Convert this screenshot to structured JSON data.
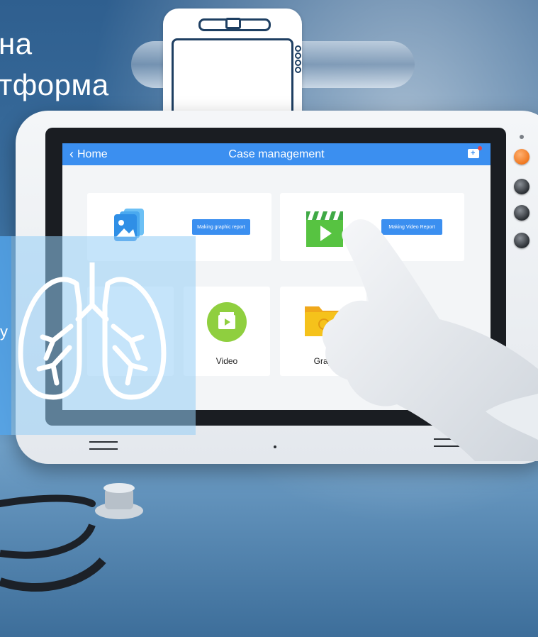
{
  "promo": {
    "line1": "на",
    "line2": "тформа",
    "side_fragment": "у"
  },
  "app": {
    "back_label": "Home",
    "title": "Case management",
    "cards": {
      "graphic_report_button": "Making graphic report",
      "video_report_button": "Making Video Report",
      "small_items": [
        {
          "label": ""
        },
        {
          "label": "Video"
        },
        {
          "label": "Grap"
        }
      ]
    },
    "icons": {
      "back": "chevron-left-icon",
      "add_case": "add-case-icon",
      "gallery": "gallery-icon",
      "clapper": "video-clapper-icon",
      "video": "video-circle-icon",
      "folder": "folder-icon"
    }
  },
  "colors": {
    "app_bar": "#3b8ff0",
    "power_button": "#f07820",
    "video_green": "#8fcf3f",
    "folder_yellow": "#f5c21b"
  }
}
